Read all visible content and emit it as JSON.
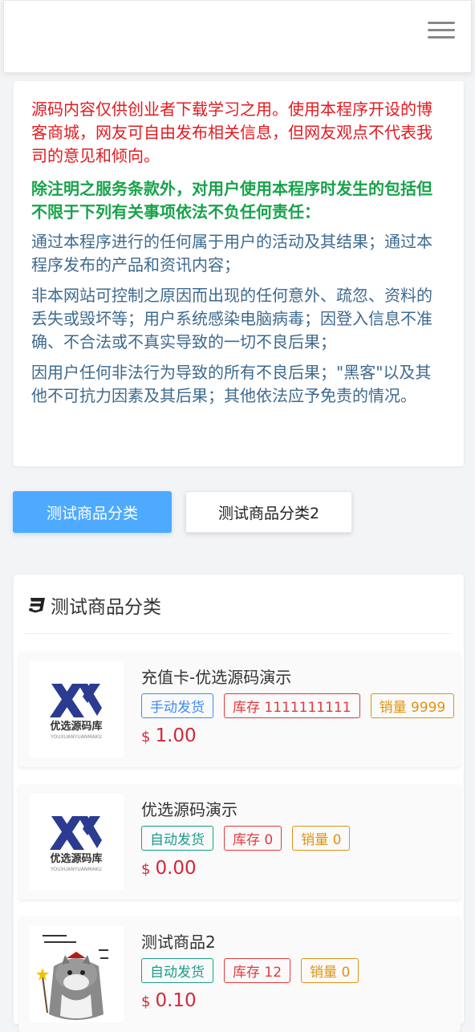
{
  "header": {
    "menu_icon": "hamburger-menu-icon"
  },
  "notice": {
    "p1": "源码内容仅供创业者下载学习之用。使用本程序开设的博客商城，网友可自由发布相关信息，但网友观点不代表我司的意见和倾向。",
    "p2": "除注明之服务条款外，对用户使用本程序时发生的包括但不限于下列有关事项依法不负任何责任：",
    "p3": "通过本程序进行的任何属于用户的活动及其结果；通过本程序发布的产品和资讯内容；",
    "p4": "非本网站可控制之原因而出现的任何意外、疏忽、资料的丢失或毁坏等；用户系统感染电脑病毒；因登入信息不准确、不合法或不真实导致的一切不良后果；",
    "p5": "因用户任何非法行为导致的所有不良后果；\"黑客\"以及其他不可抗力因素及其后果；其他依法应予免责的情况。"
  },
  "tabs": [
    {
      "label": "测试商品分类",
      "active": true
    },
    {
      "label": "测试商品分类2",
      "active": false
    }
  ],
  "category": {
    "title": "测试商品分类",
    "icon": "css3-icon",
    "products": [
      {
        "name": "充值卡-优选源码演示",
        "delivery": "手动发货",
        "stock": "库存 1111111111",
        "sales": "销量 9999",
        "currency": "$",
        "price": "1.00",
        "logo_text": "优选源码库",
        "logo_sub": "YOUXUANYUANMAKU"
      },
      {
        "name": "优选源码演示",
        "delivery": "自动发货",
        "stock": "库存 0",
        "sales": "销量 0",
        "currency": "$",
        "price": "0.00",
        "logo_text": "优选源码库",
        "logo_sub": "YOUXUANYUANMAKU"
      },
      {
        "name": "测试商品2",
        "delivery": "自动发货",
        "stock": "库存 12",
        "sales": "销量 0",
        "currency": "$",
        "price": "0.10"
      }
    ]
  },
  "colors": {
    "accent": "#4eaaff",
    "price": "#d4283a",
    "notice_red": "#e4191f",
    "notice_green": "#17a34a",
    "notice_blue": "#3e6a8e"
  }
}
